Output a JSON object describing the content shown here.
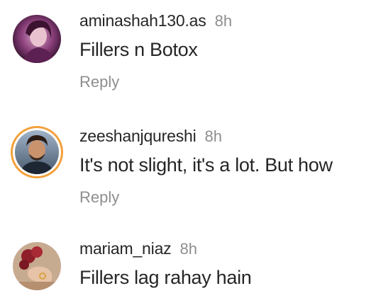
{
  "comments": [
    {
      "username": "aminashah130.as",
      "time": "8h",
      "text": "Fillers n Botox",
      "reply_label": "Reply"
    },
    {
      "username": "zeeshanjqureshi",
      "time": "8h",
      "text": "It's not slight, it's a lot. But how",
      "reply_label": "Reply"
    },
    {
      "username": "mariam_niaz",
      "time": "8h",
      "text": "Fillers lag rahay hain"
    }
  ],
  "colors": {
    "primary_text": "#262626",
    "secondary_text": "#8e8e8e",
    "story_ring": "#f4a13c"
  }
}
